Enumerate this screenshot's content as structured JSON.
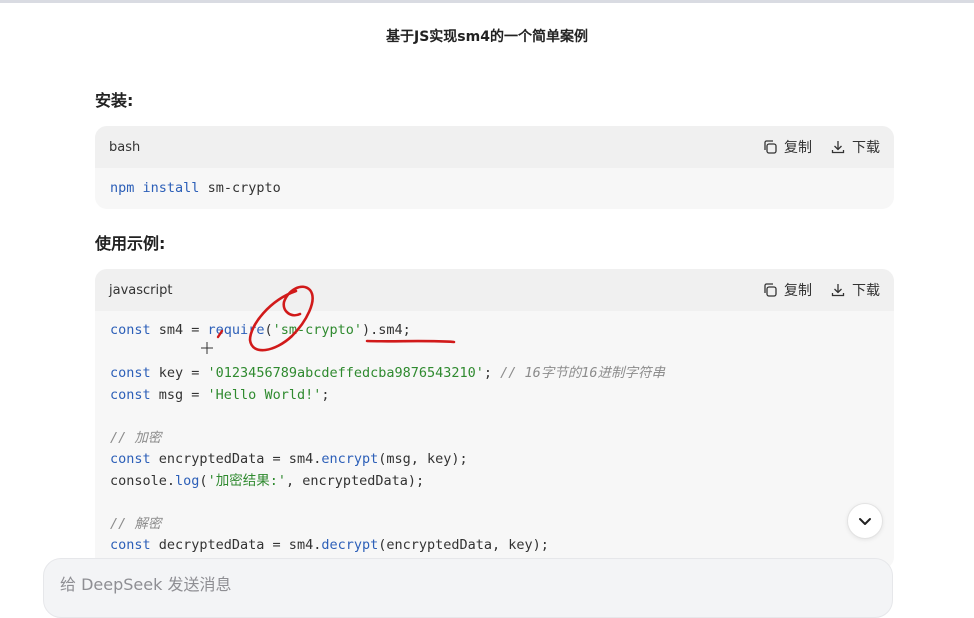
{
  "page": {
    "title": "基于JS实现sm4的一个简单案例"
  },
  "sections": [
    {
      "heading": "安装:"
    },
    {
      "heading": "使用示例:"
    }
  ],
  "blocks": [
    {
      "language": "bash",
      "copy_label": "复制",
      "download_label": "下载",
      "code": {
        "kw1": "npm",
        "kw2": "install",
        "rest": " sm-crypto"
      }
    },
    {
      "language": "javascript",
      "copy_label": "复制",
      "download_label": "下载",
      "lines": {
        "l1": {
          "kw": "const",
          "mid": " sm4 = ",
          "fn": "require",
          "open": "(",
          "str": "'sm-crypto'",
          "rest": ").sm4;"
        },
        "l3": {
          "kw": "const",
          "mid": " key = ",
          "str": "'0123456789abcdeffedcba9876543210'",
          "semi": "; ",
          "cm": "// 16字节的16进制字符串"
        },
        "l4": {
          "kw": "const",
          "mid": " msg = ",
          "str": "'Hello World!'",
          "semi": ";"
        },
        "l6": {
          "cm": "// 加密"
        },
        "l7": {
          "kw": "const",
          "mid": " encryptedData = sm4.",
          "fn": "encrypt",
          "rest": "(msg, key);"
        },
        "l8": {
          "pre": "console.",
          "fn": "log",
          "open": "(",
          "str": "'加密结果:'",
          "rest": ", encryptedData);"
        },
        "l10": {
          "cm": "// 解密"
        },
        "l11": {
          "kw": "const",
          "mid": " decryptedData = sm4.",
          "fn": "decrypt",
          "rest": "(encryptedData, key);"
        }
      }
    }
  ],
  "chat_input": {
    "placeholder": "给 DeepSeek 发送消息"
  },
  "icons": {
    "copy": "copy-icon",
    "download": "download-icon",
    "scroll": "chevron-down-icon"
  },
  "colors": {
    "keyword": "#2c5fb8",
    "string": "#2f8a2f",
    "comment": "#8c8c8c",
    "annotation": "#d11a1a"
  }
}
